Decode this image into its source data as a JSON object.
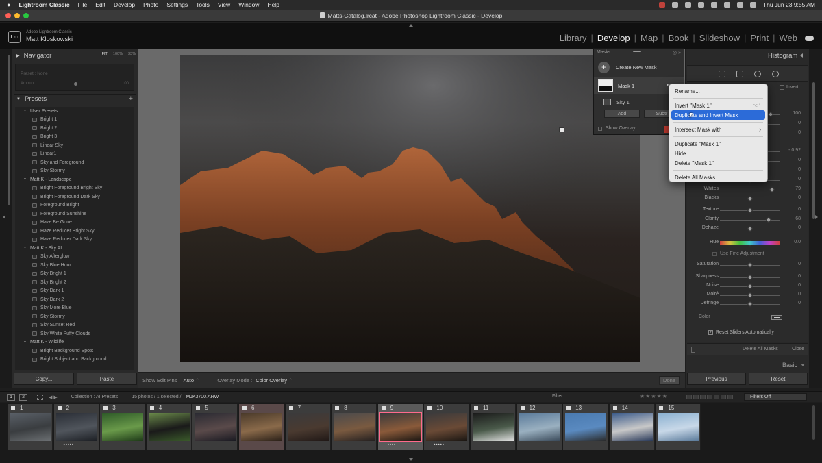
{
  "menubar": {
    "app_name": "Lightroom Classic",
    "items": [
      "File",
      "Edit",
      "Develop",
      "Photo",
      "Settings",
      "Tools",
      "View",
      "Window",
      "Help"
    ],
    "clock": "Thu Jun 23  9:55 AM"
  },
  "window": {
    "title": "Matts-Catalog.lrcat - Adobe Photoshop Lightroom Classic - Develop"
  },
  "identity": {
    "badge": "Lrc",
    "product": "Adobe Lightroom Classic",
    "user": "Matt Kloskowski"
  },
  "modules": [
    "Library",
    "Develop",
    "Map",
    "Book",
    "Slideshow",
    "Print",
    "Web"
  ],
  "active_module": "Develop",
  "navigator": {
    "title": "Navigator",
    "zoom": [
      "FIT",
      "100%",
      "33%"
    ],
    "preset_label": "Preset : None",
    "amount_label": "Amount",
    "amount_value": "100"
  },
  "presets": {
    "title": "Presets",
    "groups": [
      {
        "name": "User Presets",
        "items": [
          "Bright 1",
          "Bright 2",
          "Bright 3",
          "Linear Sky",
          "Linear1",
          "Sky and Foreground",
          "Sky Stormy"
        ]
      },
      {
        "name": "Matt K - Landscape",
        "items": [
          "Bright Foreground Bright Sky",
          "Bright Foreground Dark Sky",
          "Foreground Bright",
          "Foreground Sunshine",
          "Haze Be Gone",
          "Haze Reducer Bright Sky",
          "Haze Reducer Dark Sky"
        ]
      },
      {
        "name": "Matt K - Sky AI",
        "items": [
          "Sky Afterglow",
          "Sky Blue Hour",
          "Sky Bright 1",
          "Sky Bright 2",
          "Sky Dark 1",
          "Sky Dark 2",
          "Sky More Blue",
          "Sky Stormy",
          "Sky Sunset Red",
          "Sky White Puffy Clouds"
        ]
      },
      {
        "name": "Matt K - Wildlife",
        "items": [
          "Bright Background Spots",
          "Bright Subject and Background"
        ]
      }
    ]
  },
  "left_buttons": {
    "copy": "Copy...",
    "paste": "Paste"
  },
  "toolbar": {
    "edit_pins_label": "Show Edit Pins :",
    "edit_pins_value": "Auto",
    "overlay_mode_label": "Overlay Mode :",
    "overlay_mode_value": "Color Overlay",
    "done": "Done"
  },
  "masks_panel": {
    "title": "Masks",
    "create_new": "Create New Mask",
    "mask_name": "Mask 1",
    "component": "Sky 1",
    "add": "Add",
    "subtract": "Subtr",
    "show_overlay": "Show Overlay"
  },
  "context_menu": {
    "items": [
      {
        "label": "Rename...",
        "highlight": false
      },
      {
        "label": "Invert \"Mask 1\"",
        "shortcut": "⌥ '",
        "highlight": false
      },
      {
        "label": "Duplicate and Invert Mask",
        "highlight": true
      },
      {
        "label": "Intersect Mask with",
        "submenu": true,
        "highlight": false
      },
      {
        "label": "Duplicate \"Mask 1\"",
        "highlight": false
      },
      {
        "label": "Hide",
        "highlight": false
      },
      {
        "label": "Delete \"Mask 1\"",
        "highlight": false
      },
      {
        "label": "Delete All Masks",
        "highlight": false
      }
    ]
  },
  "right_panel": {
    "histogram": "Histogram",
    "invert": "Invert",
    "sliders": [
      {
        "label": "",
        "value": "100",
        "pos": 0.85
      },
      {
        "label": "",
        "value": "0",
        "pos": 0.5
      },
      {
        "label": "",
        "value": "0",
        "pos": 0.5
      },
      {
        "label": "",
        "value": "- 0.92",
        "pos": 0.42
      },
      {
        "label": "",
        "value": "0",
        "pos": 0.5
      },
      {
        "label": "",
        "value": "0",
        "pos": 0.5
      },
      {
        "label": "",
        "value": "0",
        "pos": 0.5
      },
      {
        "label": "Whites",
        "value": "79",
        "pos": 0.87
      },
      {
        "label": "Blacks",
        "value": "0",
        "pos": 0.5
      },
      {
        "label": "Texture",
        "value": "0",
        "pos": 0.5
      },
      {
        "label": "Clarity",
        "value": "68",
        "pos": 0.82
      },
      {
        "label": "Dehaze",
        "value": "0",
        "pos": 0.5
      },
      {
        "label": "Hue",
        "value": "0.0",
        "pos": 0.5
      },
      {
        "label": "Saturation",
        "value": "0",
        "pos": 0.5
      },
      {
        "label": "Sharpness",
        "value": "0",
        "pos": 0.5
      },
      {
        "label": "Noise",
        "value": "0",
        "pos": 0.5
      },
      {
        "label": "Moiré",
        "value": "0",
        "pos": 0.5
      },
      {
        "label": "Defringe",
        "value": "0",
        "pos": 0.5
      }
    ],
    "fine_adjustment": "Use Fine Adjustment",
    "color_label": "Color",
    "reset_sliders": "Reset Sliders Automatically",
    "delete_all_masks": "Delete All Masks",
    "close": "Close",
    "basic": "Basic",
    "previous": "Previous",
    "reset": "Reset"
  },
  "filmstrip_header": {
    "screen1": "1",
    "screen2": "2",
    "collection": "Collection : AI Presets",
    "count": "15 photos / 1 selected /",
    "filename": "_MJK3700.ARW",
    "filter": "Filter :",
    "filters_off": "Filters Off"
  },
  "filmstrip": [
    {
      "num": "1",
      "dots": "",
      "colors": [
        "#5a6068",
        "#3a3d40",
        "#6b6f72"
      ]
    },
    {
      "num": "2",
      "dots": "•••••",
      "colors": [
        "#2a2e36",
        "#50555c",
        "#1c1f24"
      ]
    },
    {
      "num": "3",
      "dots": "",
      "colors": [
        "#2e5a28",
        "#6a9a4a",
        "#1e3a18"
      ]
    },
    {
      "num": "4",
      "dots": "",
      "colors": [
        "#6a8a4a",
        "#1a1a1a",
        "#3a5a2a"
      ]
    },
    {
      "num": "5",
      "dots": "",
      "colors": [
        "#2a2a32",
        "#5a4a4a",
        "#1a1a22"
      ]
    },
    {
      "num": "6",
      "dots": "",
      "colors": [
        "#4a3a2a",
        "#8a6a4a",
        "#2a2018"
      ]
    },
    {
      "num": "7",
      "dots": "",
      "colors": [
        "#3a3a3c",
        "#4a3a30",
        "#201816"
      ]
    },
    {
      "num": "8",
      "dots": "",
      "colors": [
        "#4a4a4c",
        "#7a5a40",
        "#242020"
      ]
    },
    {
      "num": "9",
      "dots": "••••",
      "colors": [
        "#3a3a3c",
        "#8a5a3a",
        "#1a1612"
      ]
    },
    {
      "num": "10",
      "dots": "•••••",
      "colors": [
        "#3a3a3c",
        "#6a4a36",
        "#1a1612"
      ]
    },
    {
      "num": "11",
      "dots": "",
      "colors": [
        "#1a1a1a",
        "#4a5a4a",
        "#e0e0e0"
      ]
    },
    {
      "num": "12",
      "dots": "",
      "colors": [
        "#5a7a9a",
        "#9ab0c0",
        "#3a4a5a"
      ]
    },
    {
      "num": "13",
      "dots": "",
      "colors": [
        "#4a7ab0",
        "#5a8ac0",
        "#2a2a2a"
      ]
    },
    {
      "num": "14",
      "dots": "",
      "colors": [
        "#3a5a8a",
        "#c8c8c8",
        "#2a3a5a"
      ]
    },
    {
      "num": "15",
      "dots": "",
      "colors": [
        "#8ab0d0",
        "#c8d8e8",
        "#5a7a9a"
      ]
    }
  ],
  "selected_frame": "9",
  "colors": {
    "highlight": "#2c6bd8",
    "selection_outline": "#ff6a8c"
  }
}
